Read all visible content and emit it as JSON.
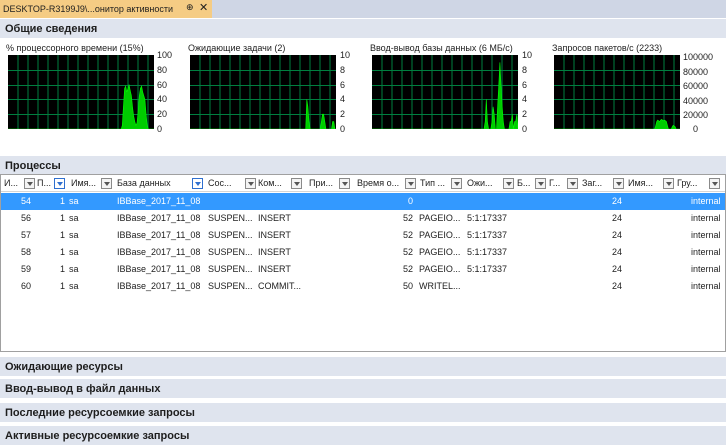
{
  "tab": {
    "title": "DESKTOP-R3199J9\\...онитор активности",
    "pin": "⊕",
    "close": "✕"
  },
  "sections": {
    "overview": "Общие сведения",
    "processes": "Процессы",
    "waits": "Ожидающие ресурсы",
    "file_io": "Ввод-вывод в файл данных",
    "recent_queries": "Последние ресурсоемкие запросы",
    "active_queries": "Активные ресурсоемкие запросы"
  },
  "charts": [
    {
      "title": "% процессорного времени (15%)",
      "ticks": [
        "100",
        "80",
        "60",
        "40",
        "20",
        "0"
      ],
      "ymax": 100,
      "values": [
        0,
        0,
        0,
        0,
        0,
        0,
        0,
        0,
        0,
        0,
        0,
        0,
        0,
        0,
        0,
        0,
        0,
        0,
        0,
        0,
        0,
        0,
        0,
        0,
        0,
        0,
        0,
        0,
        0,
        0,
        0,
        0,
        0,
        0,
        0,
        0,
        0,
        0,
        0,
        0,
        0,
        0,
        0,
        0,
        0,
        0,
        0,
        0,
        0,
        0,
        0,
        0,
        0,
        0,
        0,
        0,
        0,
        0,
        0,
        0,
        0,
        0,
        0,
        0,
        0,
        0,
        0,
        0,
        0,
        0,
        0,
        0,
        0,
        0,
        0,
        0,
        0,
        0,
        0,
        0,
        0,
        0,
        0,
        0,
        0,
        0,
        0,
        0,
        0,
        0,
        0,
        0,
        0,
        0,
        0,
        0,
        0,
        0,
        0,
        0,
        0,
        5,
        30,
        55,
        58,
        50,
        55,
        60,
        52,
        45,
        30,
        18,
        10,
        5,
        8,
        25,
        45,
        55,
        58,
        50,
        45,
        40,
        20,
        5,
        0,
        0,
        0,
        0,
        0,
        0
      ]
    },
    {
      "title": "Ожидающие задачи (2)",
      "ticks": [
        "10",
        "8",
        "6",
        "4",
        "2",
        "0"
      ],
      "ymax": 10,
      "values": [
        0,
        0,
        0,
        0,
        0,
        0,
        0,
        0,
        0,
        0,
        0,
        0,
        0,
        0,
        0,
        0,
        0,
        0,
        0,
        0,
        0,
        0,
        0,
        0,
        0,
        0,
        0,
        0,
        0,
        0,
        0,
        0,
        0,
        0,
        0,
        0,
        0,
        0,
        0,
        0,
        0,
        0,
        0,
        0,
        0,
        0,
        0,
        0,
        0,
        0,
        0,
        0,
        0,
        0,
        0,
        0,
        0,
        0,
        0,
        0,
        0,
        0,
        0,
        0,
        0,
        0,
        0,
        0,
        0,
        0,
        0,
        0,
        0,
        0,
        0,
        0,
        0,
        0,
        0,
        0,
        0,
        0,
        0,
        0,
        0,
        0,
        0,
        0,
        0,
        0,
        0,
        0,
        0,
        0,
        0,
        0,
        0,
        0,
        0,
        0,
        0,
        0,
        0,
        0,
        4,
        3,
        1,
        0,
        0,
        0,
        0,
        0,
        0,
        0,
        0,
        0,
        0,
        1,
        2,
        2,
        1,
        0,
        0,
        0,
        0,
        0,
        0,
        1,
        1,
        0,
        0
      ]
    },
    {
      "title": "Ввод-вывод базы данных (6 МБ/с)",
      "ticks": [
        "10",
        "8",
        "6",
        "4",
        "2",
        "0"
      ],
      "ymax": 10,
      "values": [
        0,
        0,
        0,
        0,
        0,
        0,
        0,
        0,
        0,
        0,
        0,
        0,
        0,
        0,
        0,
        0,
        0,
        0,
        0,
        0,
        0,
        0,
        0,
        0,
        0,
        0,
        0,
        0,
        0,
        0,
        0,
        0,
        0,
        0,
        0,
        0,
        0,
        0,
        0,
        0,
        0,
        0,
        0,
        0,
        0,
        0,
        0,
        0,
        0,
        0,
        0,
        0,
        0,
        0,
        0,
        0,
        0,
        0,
        0,
        0,
        0,
        0,
        0,
        0,
        0,
        0,
        0,
        0,
        0,
        0,
        0,
        0,
        0,
        0,
        0,
        0,
        0,
        0,
        0,
        0,
        0,
        0,
        0,
        0,
        0,
        0,
        0,
        0,
        0,
        0,
        0,
        0,
        0,
        0,
        0,
        0,
        0,
        0,
        0,
        0,
        1,
        4,
        1,
        0,
        0,
        0,
        1,
        3,
        2,
        0,
        0,
        3,
        6,
        9,
        6,
        3,
        1,
        0,
        0,
        0,
        0,
        0,
        1,
        1,
        2,
        0,
        1,
        1,
        2,
        0
      ]
    },
    {
      "title": "Запросов пакетов/с (2233)",
      "ticks": [
        "100000",
        "80000",
        "60000",
        "40000",
        "20000",
        "0"
      ],
      "ymax": 100000,
      "values": [
        0,
        0,
        0,
        0,
        0,
        0,
        0,
        0,
        0,
        0,
        0,
        0,
        0,
        0,
        0,
        0,
        0,
        0,
        0,
        0,
        0,
        0,
        0,
        0,
        0,
        0,
        0,
        0,
        0,
        0,
        0,
        0,
        0,
        0,
        0,
        0,
        0,
        0,
        0,
        0,
        0,
        0,
        0,
        0,
        0,
        0,
        0,
        0,
        0,
        0,
        0,
        0,
        0,
        0,
        0,
        0,
        0,
        0,
        0,
        0,
        0,
        0,
        0,
        0,
        0,
        0,
        0,
        0,
        0,
        0,
        0,
        0,
        0,
        0,
        0,
        0,
        0,
        0,
        0,
        0,
        0,
        0,
        0,
        0,
        0,
        0,
        0,
        0,
        0,
        0,
        0,
        0,
        0,
        0,
        0,
        0,
        0,
        0,
        0,
        0,
        0,
        0,
        0,
        0,
        0,
        5000,
        10000,
        12000,
        11000,
        10000,
        12000,
        13000,
        12000,
        11000,
        12000,
        11000,
        10000,
        5000,
        0,
        0,
        0,
        0,
        3000,
        5000,
        4000,
        3000,
        0,
        0,
        0,
        0,
        0
      ]
    }
  ],
  "columns": [
    "И...",
    "П...",
    "Имя...",
    "База данных",
    "Сос...",
    "Ком...",
    "При...",
    "Время о...",
    "Тип ...",
    "Ожи...",
    "Б...",
    "Г...",
    "Заг...",
    "Имя...",
    "Гру..."
  ],
  "rows": [
    [
      "54",
      "1",
      "sa",
      "IBBase_2017_11_08",
      "",
      "",
      "",
      "",
      "0",
      "",
      "",
      "",
      "24",
      "",
      "internal"
    ],
    [
      "56",
      "1",
      "sa",
      "IBBase_2017_11_08",
      "SUSPEN...",
      "INSERT",
      "",
      "",
      "52",
      "PAGEIO...",
      "5:1:17337",
      "",
      "24",
      "",
      "internal"
    ],
    [
      "57",
      "1",
      "sa",
      "IBBase_2017_11_08",
      "SUSPEN...",
      "INSERT",
      "",
      "",
      "52",
      "PAGEIO...",
      "5:1:17337",
      "",
      "24",
      "",
      "internal"
    ],
    [
      "58",
      "1",
      "sa",
      "IBBase_2017_11_08",
      "SUSPEN...",
      "INSERT",
      "",
      "",
      "52",
      "PAGEIO...",
      "5:1:17337",
      "",
      "24",
      "",
      "internal"
    ],
    [
      "59",
      "1",
      "sa",
      "IBBase_2017_11_08",
      "SUSPEN...",
      "INSERT",
      "",
      "",
      "52",
      "PAGEIO...",
      "5:1:17337",
      "",
      "24",
      "",
      "internal"
    ],
    [
      "60",
      "1",
      "sa",
      "IBBase_2017_11_08",
      "SUSPEN...",
      "COMMIT...",
      "",
      "",
      "50",
      "WRITEL...",
      "",
      "",
      "24",
      "",
      "internal"
    ]
  ],
  "selected_row": 0,
  "colors": {
    "plot_bg": "#000000",
    "grid": "#008040",
    "series": "#00cc00",
    "selected": "#3399ff"
  }
}
